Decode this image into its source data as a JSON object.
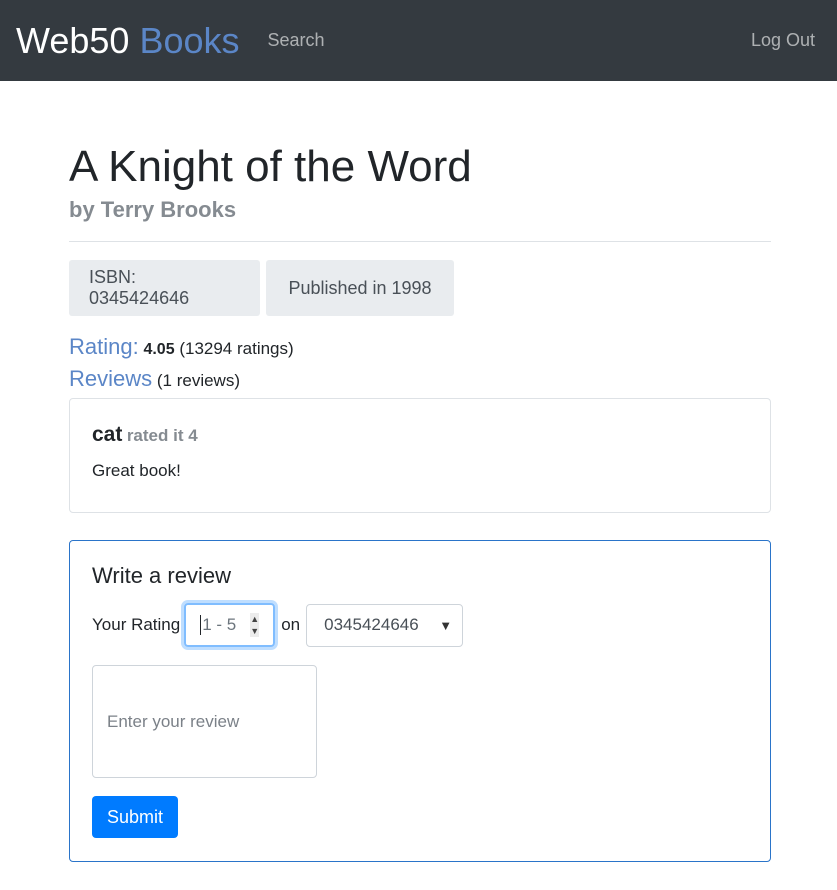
{
  "navbar": {
    "brand_main": "Web50",
    "brand_accent": "Books",
    "search_link": "Search",
    "logout_link": "Log Out"
  },
  "book": {
    "title": "A Knight of the Word",
    "author": "by Terry Brooks",
    "isbn_label": "ISBN: 0345424646",
    "published_label": "Published in 1998"
  },
  "rating": {
    "label": "Rating:",
    "score": "4.05",
    "count": "(13294 ratings)"
  },
  "reviews": {
    "label": "Reviews",
    "count": "(1 reviews)",
    "items": [
      {
        "user": "cat",
        "rated": "rated it 4",
        "text": "Great book!"
      }
    ]
  },
  "write_review": {
    "title": "Write a review",
    "rating_label": "Your Rating",
    "rating_placeholder": "1 - 5",
    "on_label": "on",
    "isbn_selected": "0345424646",
    "review_placeholder": "Enter your review",
    "submit_label": "Submit"
  },
  "colors": {
    "navbar_bg": "#343a40",
    "accent": "#5b86c7",
    "primary": "#007bff"
  }
}
